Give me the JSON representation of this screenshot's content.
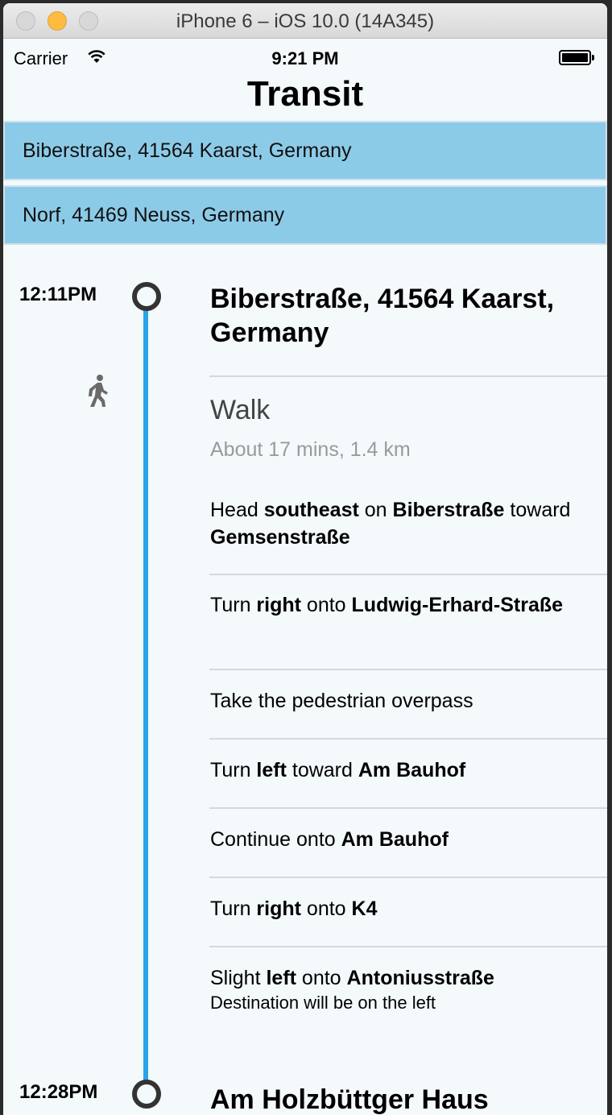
{
  "window": {
    "title": "iPhone 6 – iOS 10.0 (14A345)"
  },
  "status_bar": {
    "carrier": "Carrier",
    "time": "9:21 PM"
  },
  "nav": {
    "title": "Transit"
  },
  "route": {
    "from": "Biberstraße, 41564 Kaarst, Germany",
    "to": "Norf, 41469 Neuss, Germany"
  },
  "timeline": {
    "start_time": "12:11PM",
    "start_stop": "Biberstraße, 41564 Kaarst, Germany",
    "mode": "Walk",
    "duration": "About 17 mins, 1.4 km",
    "end_time": "12:28PM",
    "end_stop": "Am Holzbüttger Haus",
    "steps": [
      {
        "parts": [
          [
            "Head ",
            false
          ],
          [
            "southeast",
            true
          ],
          [
            " on ",
            false
          ],
          [
            "Biberstraße",
            true
          ],
          [
            " toward ",
            false
          ],
          [
            "Gemsenstraße",
            true
          ]
        ]
      },
      {
        "parts": [
          [
            "Turn ",
            false
          ],
          [
            "right",
            true
          ],
          [
            " onto ",
            false
          ],
          [
            "Ludwig-Erhard-Straße",
            true
          ]
        ]
      },
      {
        "parts": [
          [
            "Take the pedestrian overpass",
            false
          ]
        ]
      },
      {
        "parts": [
          [
            "Turn ",
            false
          ],
          [
            "left",
            true
          ],
          [
            " toward ",
            false
          ],
          [
            "Am Bauhof",
            true
          ]
        ]
      },
      {
        "parts": [
          [
            "Continue onto ",
            false
          ],
          [
            "Am Bauhof",
            true
          ]
        ]
      },
      {
        "parts": [
          [
            "Turn ",
            false
          ],
          [
            "right",
            true
          ],
          [
            " onto ",
            false
          ],
          [
            "K4",
            true
          ]
        ]
      },
      {
        "parts": [
          [
            "Slight ",
            false
          ],
          [
            "left",
            true
          ],
          [
            " onto ",
            false
          ],
          [
            "Antoniusstraße",
            true
          ]
        ],
        "note": "Destination will be on the left"
      }
    ]
  },
  "colors": {
    "route_line": "#2aa5e8",
    "field_bg": "#8ccbe8",
    "background": "#f4f9fc"
  },
  "icons": {
    "walk": "walking-person-icon",
    "wifi": "wifi-icon",
    "battery": "battery-icon"
  }
}
